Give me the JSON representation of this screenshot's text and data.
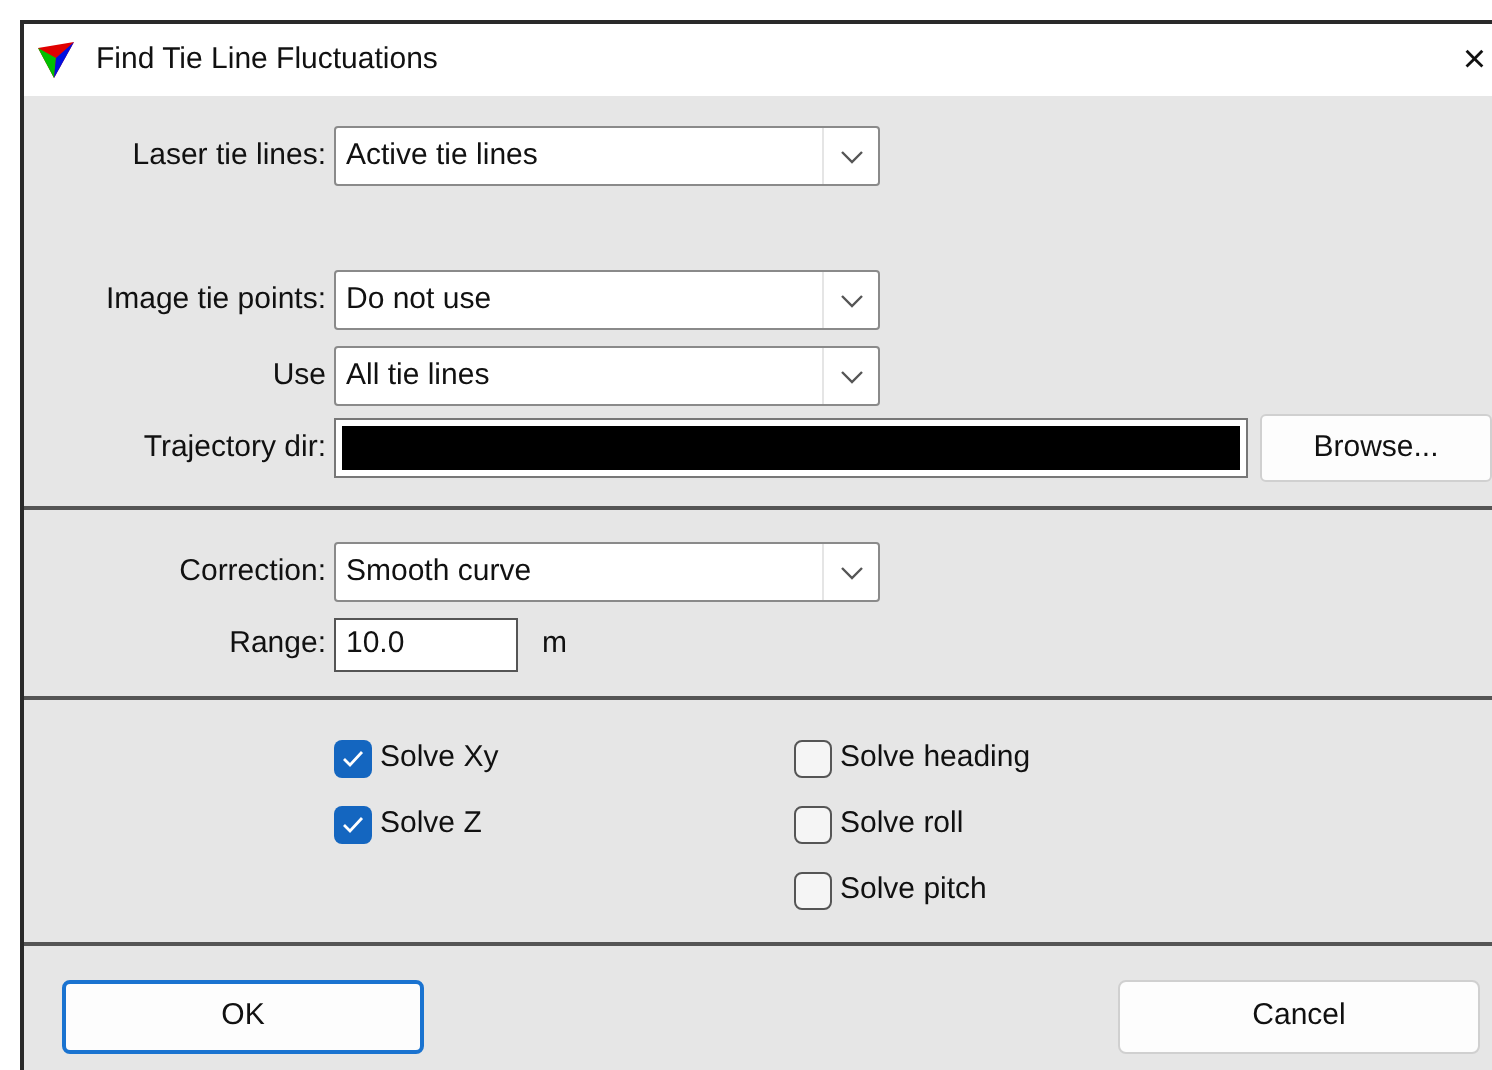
{
  "window": {
    "title": "Find Tie Line Fluctuations",
    "close": "×"
  },
  "laser_tie_lines": {
    "label": "Laser tie lines:",
    "value": "Active tie lines"
  },
  "image_tie_points": {
    "label": "Image tie points:",
    "value": "Do not use"
  },
  "use": {
    "label": "Use",
    "value": "All tie lines"
  },
  "trajectory_dir": {
    "label": "Trajectory dir:",
    "redacted": true
  },
  "browse_button": "Browse...",
  "correction": {
    "label": "Correction:",
    "value": "Smooth curve"
  },
  "range": {
    "label": "Range:",
    "value": "10.0",
    "unit": "m"
  },
  "checkboxes_left": [
    {
      "label": "Solve Xy",
      "checked": true
    },
    {
      "label": "Solve Z",
      "checked": true
    }
  ],
  "checkboxes_right": [
    {
      "label": "Solve heading",
      "checked": false
    },
    {
      "label": "Solve roll",
      "checked": false
    },
    {
      "label": "Solve pitch",
      "checked": false
    }
  ],
  "buttons": [
    {
      "label": "OK",
      "selected": true
    },
    {
      "label": "Cancel",
      "selected": false
    }
  ]
}
